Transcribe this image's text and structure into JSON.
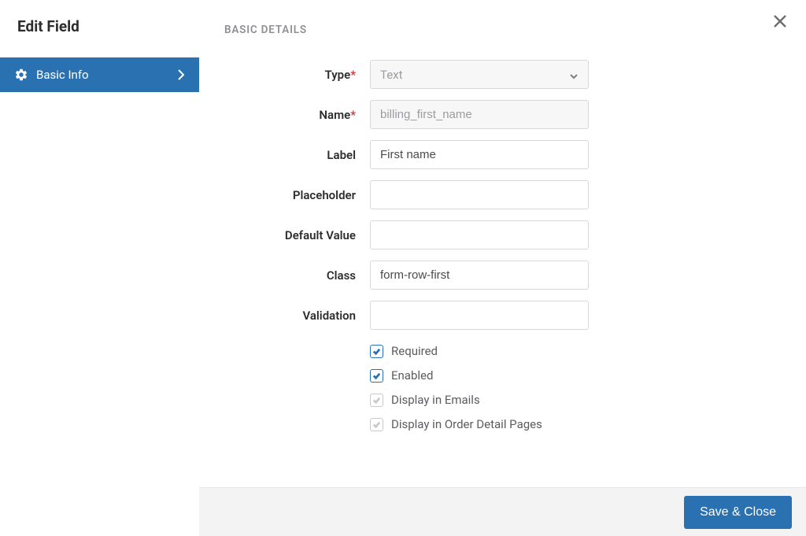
{
  "sidebar": {
    "title": "Edit Field",
    "items": [
      {
        "label": "Basic Info"
      }
    ]
  },
  "main": {
    "section_title": "BASIC DETAILS",
    "fields": {
      "type": {
        "label": "Type",
        "required": true,
        "value": "Text"
      },
      "name": {
        "label": "Name",
        "required": true,
        "value": "billing_first_name"
      },
      "label_field": {
        "label": "Label",
        "value": "First name"
      },
      "placeholder": {
        "label": "Placeholder",
        "value": ""
      },
      "default_value": {
        "label": "Default Value",
        "value": ""
      },
      "class": {
        "label": "Class",
        "value": "form-row-first"
      },
      "validation": {
        "label": "Validation",
        "value": ""
      }
    },
    "checkboxes": [
      {
        "label": "Required",
        "checked": true,
        "enabled": true
      },
      {
        "label": "Enabled",
        "checked": true,
        "enabled": true
      },
      {
        "label": "Display in Emails",
        "checked": true,
        "enabled": false
      },
      {
        "label": "Display in Order Detail Pages",
        "checked": true,
        "enabled": false
      }
    ]
  },
  "footer": {
    "save_label": "Save & Close"
  }
}
